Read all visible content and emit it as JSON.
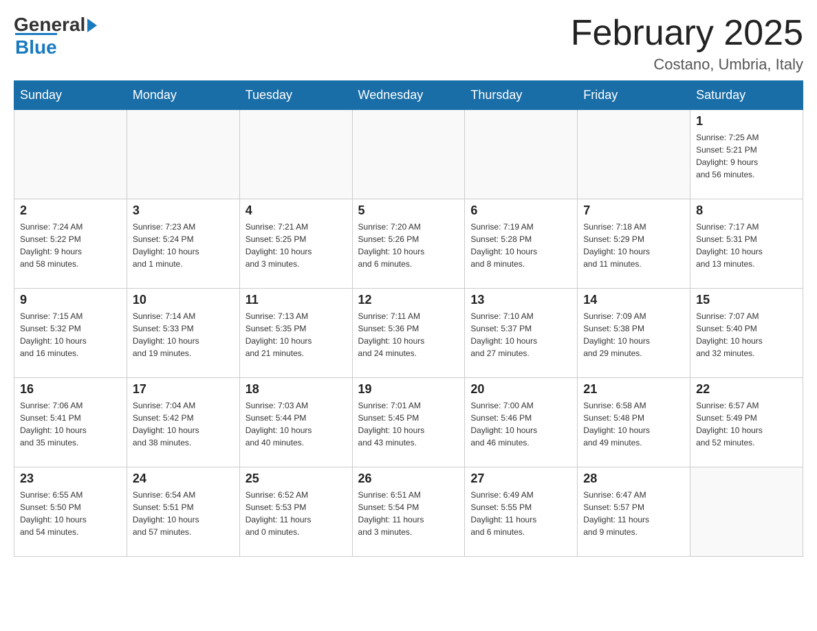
{
  "header": {
    "logo_general": "General",
    "logo_blue": "Blue",
    "month_title": "February 2025",
    "location": "Costano, Umbria, Italy"
  },
  "days_of_week": [
    "Sunday",
    "Monday",
    "Tuesday",
    "Wednesday",
    "Thursday",
    "Friday",
    "Saturday"
  ],
  "weeks": [
    [
      {
        "day": "",
        "info": ""
      },
      {
        "day": "",
        "info": ""
      },
      {
        "day": "",
        "info": ""
      },
      {
        "day": "",
        "info": ""
      },
      {
        "day": "",
        "info": ""
      },
      {
        "day": "",
        "info": ""
      },
      {
        "day": "1",
        "info": "Sunrise: 7:25 AM\nSunset: 5:21 PM\nDaylight: 9 hours\nand 56 minutes."
      }
    ],
    [
      {
        "day": "2",
        "info": "Sunrise: 7:24 AM\nSunset: 5:22 PM\nDaylight: 9 hours\nand 58 minutes."
      },
      {
        "day": "3",
        "info": "Sunrise: 7:23 AM\nSunset: 5:24 PM\nDaylight: 10 hours\nand 1 minute."
      },
      {
        "day": "4",
        "info": "Sunrise: 7:21 AM\nSunset: 5:25 PM\nDaylight: 10 hours\nand 3 minutes."
      },
      {
        "day": "5",
        "info": "Sunrise: 7:20 AM\nSunset: 5:26 PM\nDaylight: 10 hours\nand 6 minutes."
      },
      {
        "day": "6",
        "info": "Sunrise: 7:19 AM\nSunset: 5:28 PM\nDaylight: 10 hours\nand 8 minutes."
      },
      {
        "day": "7",
        "info": "Sunrise: 7:18 AM\nSunset: 5:29 PM\nDaylight: 10 hours\nand 11 minutes."
      },
      {
        "day": "8",
        "info": "Sunrise: 7:17 AM\nSunset: 5:31 PM\nDaylight: 10 hours\nand 13 minutes."
      }
    ],
    [
      {
        "day": "9",
        "info": "Sunrise: 7:15 AM\nSunset: 5:32 PM\nDaylight: 10 hours\nand 16 minutes."
      },
      {
        "day": "10",
        "info": "Sunrise: 7:14 AM\nSunset: 5:33 PM\nDaylight: 10 hours\nand 19 minutes."
      },
      {
        "day": "11",
        "info": "Sunrise: 7:13 AM\nSunset: 5:35 PM\nDaylight: 10 hours\nand 21 minutes."
      },
      {
        "day": "12",
        "info": "Sunrise: 7:11 AM\nSunset: 5:36 PM\nDaylight: 10 hours\nand 24 minutes."
      },
      {
        "day": "13",
        "info": "Sunrise: 7:10 AM\nSunset: 5:37 PM\nDaylight: 10 hours\nand 27 minutes."
      },
      {
        "day": "14",
        "info": "Sunrise: 7:09 AM\nSunset: 5:38 PM\nDaylight: 10 hours\nand 29 minutes."
      },
      {
        "day": "15",
        "info": "Sunrise: 7:07 AM\nSunset: 5:40 PM\nDaylight: 10 hours\nand 32 minutes."
      }
    ],
    [
      {
        "day": "16",
        "info": "Sunrise: 7:06 AM\nSunset: 5:41 PM\nDaylight: 10 hours\nand 35 minutes."
      },
      {
        "day": "17",
        "info": "Sunrise: 7:04 AM\nSunset: 5:42 PM\nDaylight: 10 hours\nand 38 minutes."
      },
      {
        "day": "18",
        "info": "Sunrise: 7:03 AM\nSunset: 5:44 PM\nDaylight: 10 hours\nand 40 minutes."
      },
      {
        "day": "19",
        "info": "Sunrise: 7:01 AM\nSunset: 5:45 PM\nDaylight: 10 hours\nand 43 minutes."
      },
      {
        "day": "20",
        "info": "Sunrise: 7:00 AM\nSunset: 5:46 PM\nDaylight: 10 hours\nand 46 minutes."
      },
      {
        "day": "21",
        "info": "Sunrise: 6:58 AM\nSunset: 5:48 PM\nDaylight: 10 hours\nand 49 minutes."
      },
      {
        "day": "22",
        "info": "Sunrise: 6:57 AM\nSunset: 5:49 PM\nDaylight: 10 hours\nand 52 minutes."
      }
    ],
    [
      {
        "day": "23",
        "info": "Sunrise: 6:55 AM\nSunset: 5:50 PM\nDaylight: 10 hours\nand 54 minutes."
      },
      {
        "day": "24",
        "info": "Sunrise: 6:54 AM\nSunset: 5:51 PM\nDaylight: 10 hours\nand 57 minutes."
      },
      {
        "day": "25",
        "info": "Sunrise: 6:52 AM\nSunset: 5:53 PM\nDaylight: 11 hours\nand 0 minutes."
      },
      {
        "day": "26",
        "info": "Sunrise: 6:51 AM\nSunset: 5:54 PM\nDaylight: 11 hours\nand 3 minutes."
      },
      {
        "day": "27",
        "info": "Sunrise: 6:49 AM\nSunset: 5:55 PM\nDaylight: 11 hours\nand 6 minutes."
      },
      {
        "day": "28",
        "info": "Sunrise: 6:47 AM\nSunset: 5:57 PM\nDaylight: 11 hours\nand 9 minutes."
      },
      {
        "day": "",
        "info": ""
      }
    ]
  ]
}
